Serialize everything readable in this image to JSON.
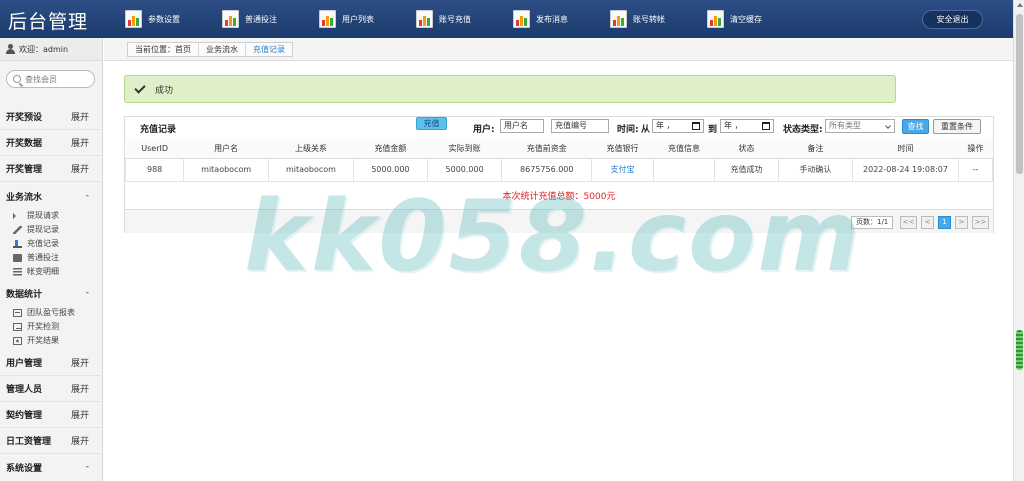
{
  "app": {
    "title": "后台管理",
    "logout_label": "安全退出"
  },
  "topnav": [
    {
      "label": "参数设置",
      "icon": "chart-icon"
    },
    {
      "label": "普通投注",
      "icon": "chart-icon"
    },
    {
      "label": "用户列表",
      "icon": "chart-icon"
    },
    {
      "label": "账号充值",
      "icon": "chart-icon"
    },
    {
      "label": "发布消息",
      "icon": "chart-icon"
    },
    {
      "label": "账号转帐",
      "icon": "chart-icon"
    },
    {
      "label": "清空缓存",
      "icon": "chart-icon"
    }
  ],
  "sidebar": {
    "welcome": "欢迎：admin",
    "search_placeholder": "查找会员",
    "groups": [
      {
        "label": "开奖预设",
        "toggle": "展开"
      },
      {
        "label": "开奖数据",
        "toggle": "展开"
      },
      {
        "label": "开奖管理",
        "toggle": "展开"
      },
      {
        "label": "业务流水",
        "toggle": "-"
      },
      {
        "label": "数据统计",
        "toggle": "-"
      },
      {
        "label": "用户管理",
        "toggle": "展开"
      },
      {
        "label": "管理人员",
        "toggle": "展开"
      },
      {
        "label": "契约管理",
        "toggle": "展开"
      },
      {
        "label": "日工资管理",
        "toggle": "展开"
      },
      {
        "label": "系统设置",
        "toggle": "-"
      }
    ],
    "business_items": [
      "提现请求",
      "提现记录",
      "充值记录",
      "普通投注",
      "帐变明细"
    ],
    "stats_items": [
      "团队盈亏报表",
      "开奖检测",
      "开奖结果"
    ]
  },
  "breadcrumb": [
    "当前位置：首页",
    "业务流水",
    "充值记录"
  ],
  "alert": {
    "text": "成功"
  },
  "panel": {
    "title": "充值记录",
    "recharge_button": "充值",
    "user_label": "用户:",
    "user_placeholder": "用户名",
    "order_placeholder": "充值编号",
    "time_label": "时间:",
    "from_label": "从",
    "to_label": "到",
    "date_placeholder": "年 ，",
    "status_label": "状态类型:",
    "status_value": "所有类型",
    "find_button": "查找",
    "reset_button": "重置条件"
  },
  "table": {
    "columns": [
      "UserID",
      "用户名",
      "上级关系",
      "充值金额",
      "实际到账",
      "充值前资金",
      "充值银行",
      "充值信息",
      "状态",
      "备注",
      "时间",
      "操作"
    ],
    "rows": [
      [
        "988",
        "mitaobocom",
        "mitaobocom",
        "5000.000",
        "5000.000",
        "8675756.000",
        "支付宝",
        "",
        "充值成功",
        "手动确认",
        "2022-08-24 19:08:07",
        "--"
      ]
    ]
  },
  "total_text": "本次统计充值总额：5000元",
  "pager": {
    "pages": "页数：1/1",
    "first": "<<",
    "prev": "<",
    "current": "1",
    "next": ">",
    "last": ">>"
  },
  "watermark": "kk058.com",
  "colors": {
    "topbar": "#1c3a6c",
    "alert_bg": "#dff0c8",
    "accent": "#4aa8e8",
    "total_red": "#e02020"
  }
}
